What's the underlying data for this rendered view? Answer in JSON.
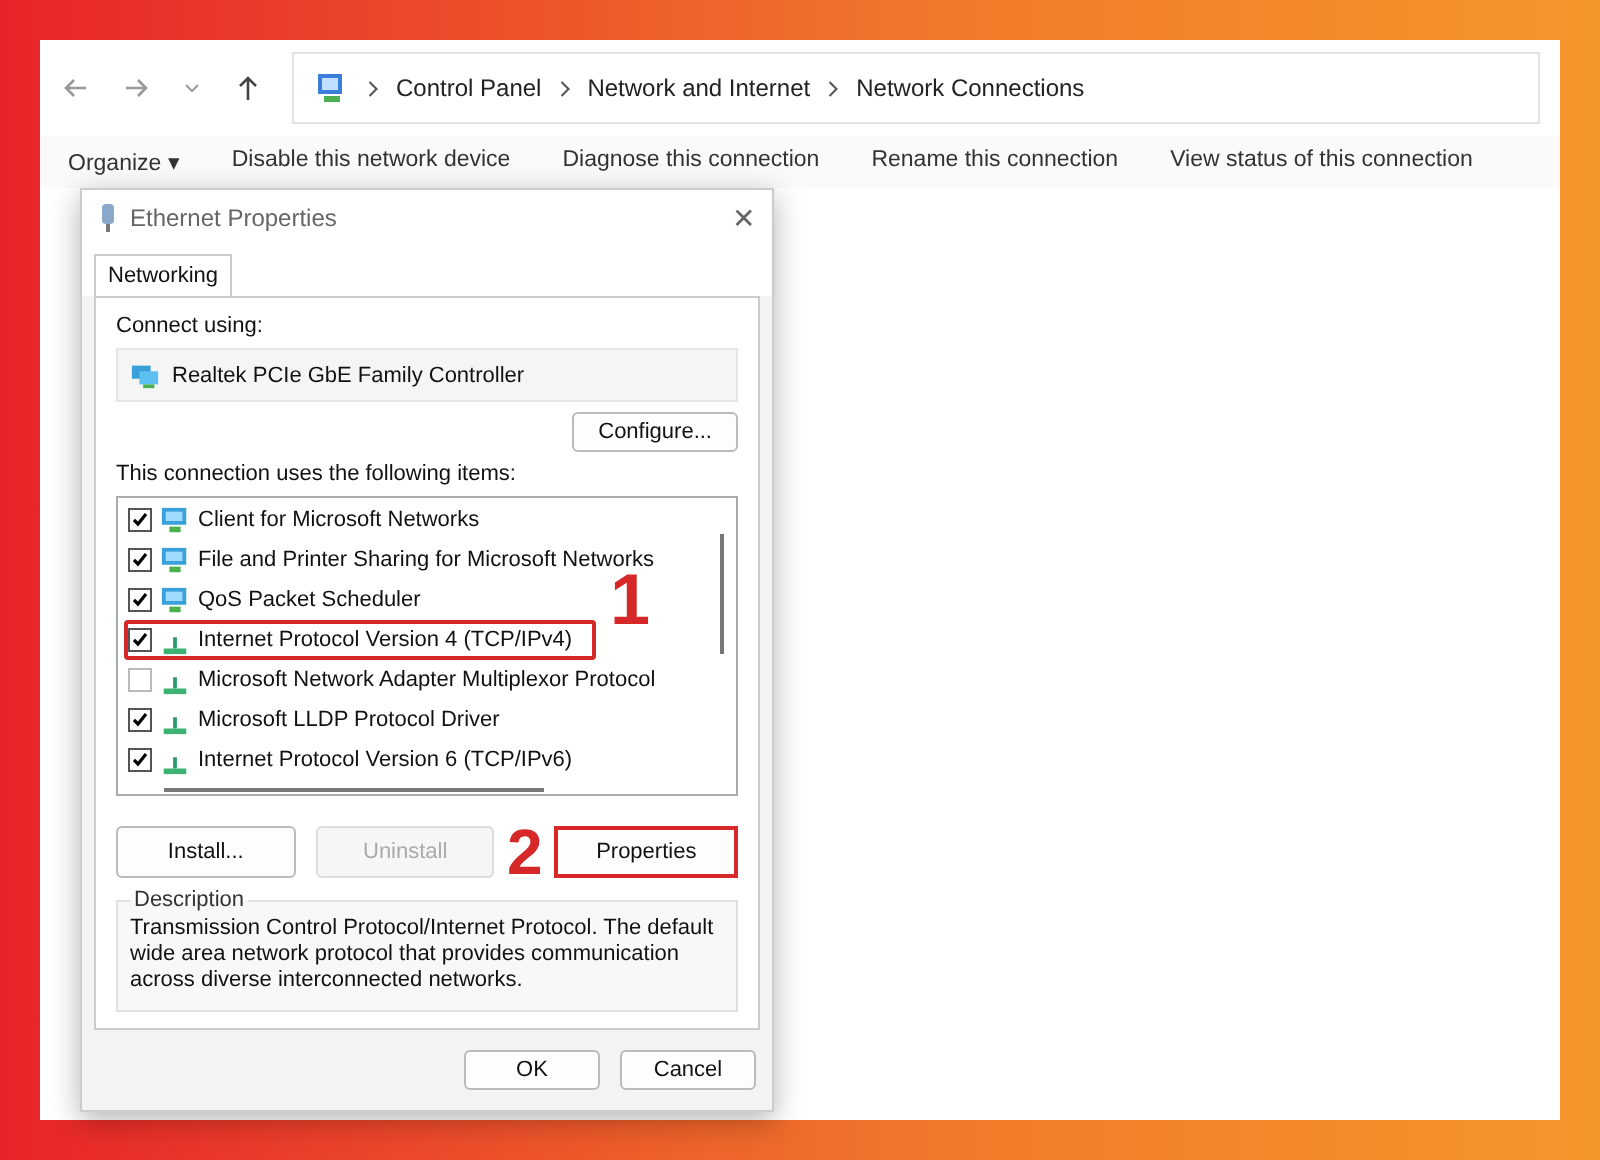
{
  "breadcrumb": [
    "Control Panel",
    "Network and Internet",
    "Network Connections"
  ],
  "toolbar": [
    "Organize ▾",
    "Disable this network device",
    "Diagnose this connection",
    "Rename this connection",
    "View status of this connection"
  ],
  "dialog": {
    "title": "Ethernet Properties",
    "close": "✕",
    "tabs": [
      {
        "label": "Networking",
        "selected": true
      }
    ],
    "connect_using_label": "Connect using:",
    "adapter": "Realtek PCIe GbE Family Controller",
    "configure_button": "Configure...",
    "items_label": "This connection uses the following items:",
    "items": [
      {
        "label": "Client for Microsoft Networks",
        "checked": true,
        "kind": "client",
        "highlighted": false
      },
      {
        "label": "File and Printer Sharing for Microsoft Networks",
        "checked": true,
        "kind": "client",
        "highlighted": false
      },
      {
        "label": "QoS Packet Scheduler",
        "checked": true,
        "kind": "client",
        "highlighted": false
      },
      {
        "label": "Internet Protocol Version 4 (TCP/IPv4)",
        "checked": true,
        "kind": "protocol",
        "highlighted": true
      },
      {
        "label": "Microsoft Network Adapter Multiplexor Protocol",
        "checked": false,
        "kind": "protocol",
        "highlighted": false
      },
      {
        "label": "Microsoft LLDP Protocol Driver",
        "checked": true,
        "kind": "protocol",
        "highlighted": false
      },
      {
        "label": "Internet Protocol Version 6 (TCP/IPv6)",
        "checked": true,
        "kind": "protocol",
        "highlighted": false
      }
    ],
    "buttons": [
      {
        "label": "Install...",
        "disabled": false,
        "highlighted": false
      },
      {
        "label": "Uninstall",
        "disabled": true,
        "highlighted": false
      },
      {
        "label": "Properties",
        "disabled": false,
        "highlighted": true
      }
    ],
    "description_title": "Description",
    "description": "Transmission Control Protocol/Internet Protocol. The default wide area network protocol that provides communication across diverse interconnected networks.",
    "footer_buttons": [
      "OK",
      "Cancel"
    ]
  },
  "callouts": [
    "1",
    "2"
  ]
}
